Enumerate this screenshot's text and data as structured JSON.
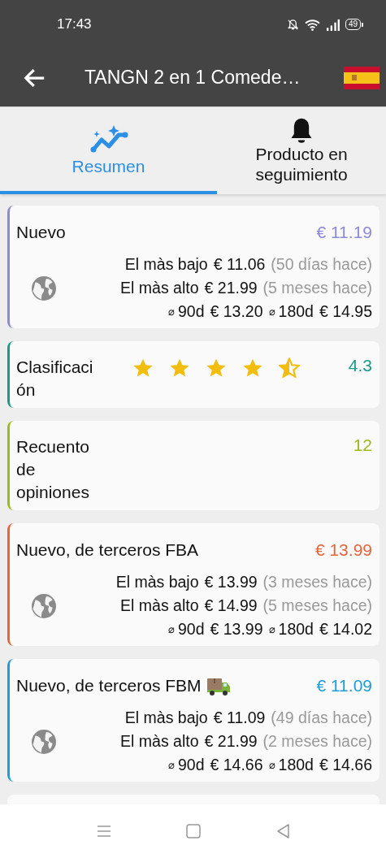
{
  "status_bar": {
    "time": "17:43",
    "battery": "49"
  },
  "app_bar": {
    "title": "TANGN 2 en 1 Comede…"
  },
  "tabs": [
    {
      "label": "Resumen",
      "selected": true
    },
    {
      "label": "Producto en seguimiento",
      "selected": false
    }
  ],
  "cards": [
    {
      "kind": "price",
      "title": "Nuevo",
      "merchant_shipped": false,
      "color": "#8c8ad6",
      "value": "€ 11.19",
      "lowest": {
        "label": "El màs bajo",
        "value": "€ 11.06",
        "note": "(50 días hace)"
      },
      "highest": {
        "label": "El màs alto",
        "value": "€ 21.99",
        "note": "(5 meses hace)"
      },
      "averages": [
        {
          "symbol": "⌀",
          "label": "90d",
          "value": "€ 13.20"
        },
        {
          "symbol": "⌀",
          "label": "180d",
          "value": "€ 14.95"
        }
      ]
    },
    {
      "kind": "rating",
      "title": "Clasificación",
      "color": "#1a9a88",
      "stars": 4.3,
      "value": "4.3"
    },
    {
      "kind": "count",
      "title": "Recuento de opiniones",
      "color": "#9cba1e",
      "value": "12"
    },
    {
      "kind": "price",
      "title": "Nuevo, de terceros FBA",
      "merchant_shipped": false,
      "color": "#e8643a",
      "value": "€ 13.99",
      "lowest": {
        "label": "El màs bajo",
        "value": "€ 13.99",
        "note": "(3 meses hace)"
      },
      "highest": {
        "label": "El màs alto",
        "value": "€ 14.99",
        "note": "(5 meses hace)"
      },
      "averages": [
        {
          "symbol": "⌀",
          "label": "90d",
          "value": "€ 13.99"
        },
        {
          "symbol": "⌀",
          "label": "180d",
          "value": "€ 14.02"
        }
      ]
    },
    {
      "kind": "price",
      "title": "Nuevo, de terceros FBM",
      "merchant_shipped": true,
      "color": "#1e9ed8",
      "value": "€ 11.09",
      "lowest": {
        "label": "El màs bajo",
        "value": "€ 11.09",
        "note": "(49 días hace)"
      },
      "highest": {
        "label": "El màs alto",
        "value": "€ 21.99",
        "note": "(2 meses hace)"
      },
      "averages": [
        {
          "symbol": "⌀",
          "label": "90d",
          "value": "€ 14.66"
        },
        {
          "symbol": "⌀",
          "label": "180d",
          "value": "€ 14.66"
        }
      ]
    }
  ]
}
